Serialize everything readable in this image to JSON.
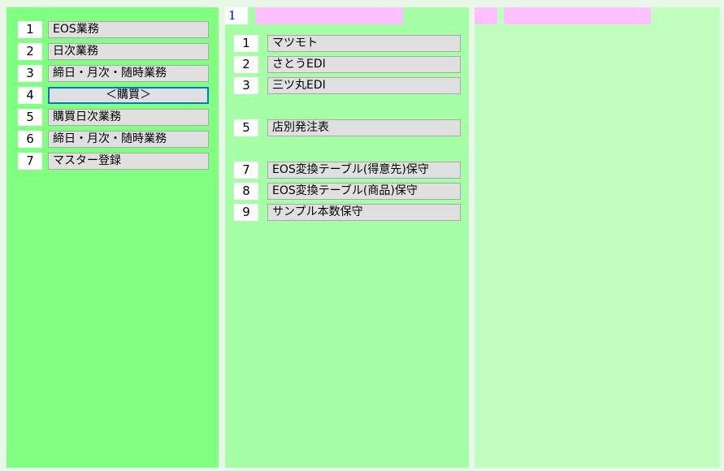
{
  "left_menu": {
    "items": [
      {
        "num": "1",
        "label": "EOS業務"
      },
      {
        "num": "2",
        "label": "日次業務"
      },
      {
        "num": "3",
        "label": "締日・月次・随時業務"
      },
      {
        "num": "4",
        "label": "＜購買＞"
      },
      {
        "num": "5",
        "label": "購買日次業務"
      },
      {
        "num": "6",
        "label": "締日・月次・随時業務"
      },
      {
        "num": "7",
        "label": "マスター登録"
      }
    ]
  },
  "middle_menu": {
    "header_num": "1",
    "items": [
      {
        "num": "1",
        "label": "マツモト"
      },
      {
        "num": "2",
        "label": "さとうEDI"
      },
      {
        "num": "3",
        "label": "三ツ丸EDI"
      },
      {
        "num": "5",
        "label": "店別発注表"
      },
      {
        "num": "7",
        "label": "EOS変換テーブル(得意先)保守"
      },
      {
        "num": "8",
        "label": "EOS変換テーブル(商品)保守"
      },
      {
        "num": "9",
        "label": "サンプル本数保守"
      }
    ]
  },
  "colors": {
    "left_panel": "#80ff80",
    "middle_panel": "#a6ffa6",
    "right_panel": "#c0ffc0",
    "header_bar": "#ffc0ff",
    "selection_border": "#0078d7"
  }
}
